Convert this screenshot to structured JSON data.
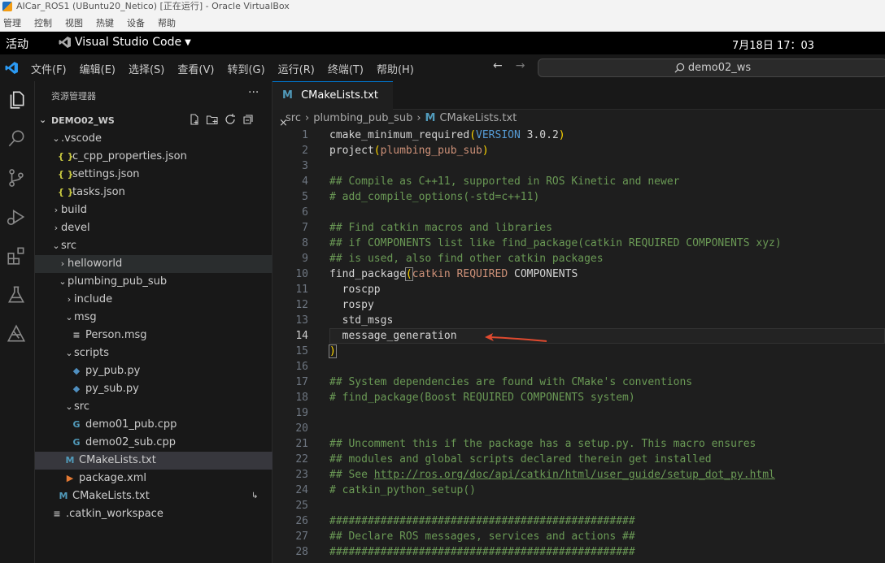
{
  "vbox": {
    "title": "AICar_ROS1 (UBuntu20_Netico) [正在运行] - Oracle VirtualBox",
    "menu": [
      "管理",
      "控制",
      "视图",
      "热键",
      "设备",
      "帮助"
    ]
  },
  "gnome": {
    "activities": "活动",
    "app": "Visual Studio Code",
    "clock": "7月18日  17：03"
  },
  "vscode": {
    "menus": [
      "文件(F)",
      "编辑(E)",
      "选择(S)",
      "查看(V)",
      "转到(G)",
      "运行(R)",
      "终端(T)",
      "帮助(H)"
    ],
    "search": "demo02_ws",
    "explorer_title": "资源管理器",
    "workspace": "DEMO02_WS",
    "tree": [
      {
        "label": ".vscode",
        "type": "folder",
        "open": true,
        "depth": 1
      },
      {
        "label": "c_cpp_properties.json",
        "type": "json",
        "depth": 2
      },
      {
        "label": "settings.json",
        "type": "json",
        "depth": 2
      },
      {
        "label": "tasks.json",
        "type": "json",
        "depth": 2
      },
      {
        "label": "build",
        "type": "folder",
        "open": false,
        "depth": 1
      },
      {
        "label": "devel",
        "type": "folder",
        "open": false,
        "depth": 1
      },
      {
        "label": "src",
        "type": "folder",
        "open": true,
        "depth": 1
      },
      {
        "label": "helloworld",
        "type": "folder",
        "open": false,
        "depth": 2
      },
      {
        "label": "plumbing_pub_sub",
        "type": "folder",
        "open": true,
        "depth": 2
      },
      {
        "label": "include",
        "type": "folder",
        "open": false,
        "depth": 3
      },
      {
        "label": "msg",
        "type": "folder",
        "open": true,
        "depth": 3
      },
      {
        "label": "Person.msg",
        "type": "lines",
        "depth": 4
      },
      {
        "label": "scripts",
        "type": "folder",
        "open": true,
        "depth": 3
      },
      {
        "label": "py_pub.py",
        "type": "py",
        "depth": 4
      },
      {
        "label": "py_sub.py",
        "type": "py",
        "depth": 4
      },
      {
        "label": "src",
        "type": "folder",
        "open": true,
        "depth": 3
      },
      {
        "label": "demo01_pub.cpp",
        "type": "cpp",
        "depth": 4
      },
      {
        "label": "demo02_sub.cpp",
        "type": "cpp",
        "depth": 4
      },
      {
        "label": "CMakeLists.txt",
        "type": "cmake",
        "depth": 3
      },
      {
        "label": "package.xml",
        "type": "xml",
        "depth": 3
      },
      {
        "label": "CMakeLists.txt",
        "type": "cmake",
        "depth": 2
      },
      {
        "label": ".catkin_workspace",
        "type": "lines",
        "depth": 1
      }
    ],
    "tab": "CMakeLists.txt",
    "breadcrumb": [
      "src",
      "plumbing_pub_sub",
      "CMakeLists.txt"
    ],
    "lines": [
      "cmake_minimum_required(VERSION 3.0.2)",
      "project(plumbing_pub_sub)",
      "",
      "## Compile as C++11, supported in ROS Kinetic and newer",
      "# add_compile_options(-std=c++11)",
      "",
      "## Find catkin macros and libraries",
      "## if COMPONENTS list like find_package(catkin REQUIRED COMPONENTS xyz)",
      "## is used, also find other catkin packages",
      "find_package(catkin REQUIRED COMPONENTS",
      "  roscpp",
      "  rospy",
      "  std_msgs",
      "  message_generation",
      ")",
      "",
      "## System dependencies are found with CMake's conventions",
      "# find_package(Boost REQUIRED COMPONENTS system)",
      "",
      "",
      "## Uncomment this if the package has a setup.py. This macro ensures",
      "## modules and global scripts declared therein get installed",
      "## See http://ros.org/doc/api/catkin/html/user_guide/setup_dot_py.html",
      "# catkin_python_setup()",
      "",
      "################################################",
      "## Declare ROS messages, services and actions ##",
      "################################################"
    ],
    "colors": {
      "accent": "#0078d4",
      "annotation": "#e04a2f"
    }
  }
}
